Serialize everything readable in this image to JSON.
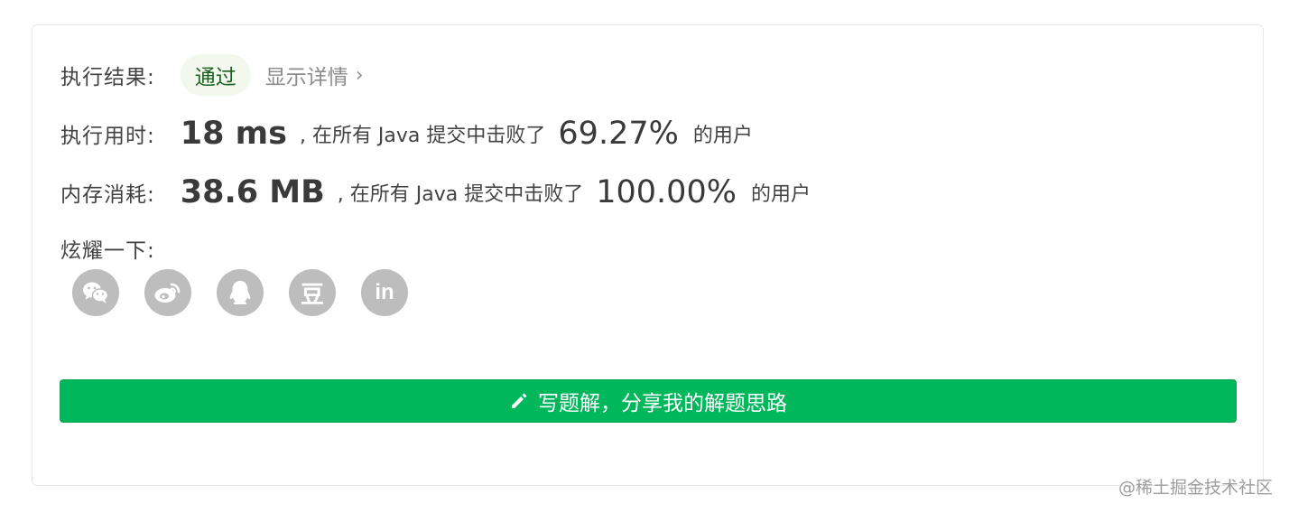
{
  "result": {
    "label": "执行结果:",
    "status": "通过",
    "details_link": "显示详情",
    "details_chevron": "›"
  },
  "runtime": {
    "label": "执行用时:",
    "value": "18 ms",
    "middle_text": ", 在所有 Java 提交中击败了",
    "percent": "69.27%",
    "tail_text": "的用户"
  },
  "memory": {
    "label": "内存消耗:",
    "value": "38.6 MB",
    "middle_text": ", 在所有 Java 提交中击败了",
    "percent": "100.00%",
    "tail_text": "的用户"
  },
  "share": {
    "label": "炫耀一下:",
    "icons": [
      "wechat-icon",
      "weibo-icon",
      "qq-icon",
      "douban-icon",
      "linkedin-icon"
    ],
    "douban_glyph": "豆",
    "linkedin_glyph": "in"
  },
  "cta": {
    "label": "写题解，分享我的解题思路",
    "icon": "pencil-icon"
  },
  "watermark": "@稀土掘金技术社区",
  "colors": {
    "accent_green": "#00b75c",
    "pill_bg": "#f2f8ee",
    "icon_gray": "#bdbdbd"
  }
}
